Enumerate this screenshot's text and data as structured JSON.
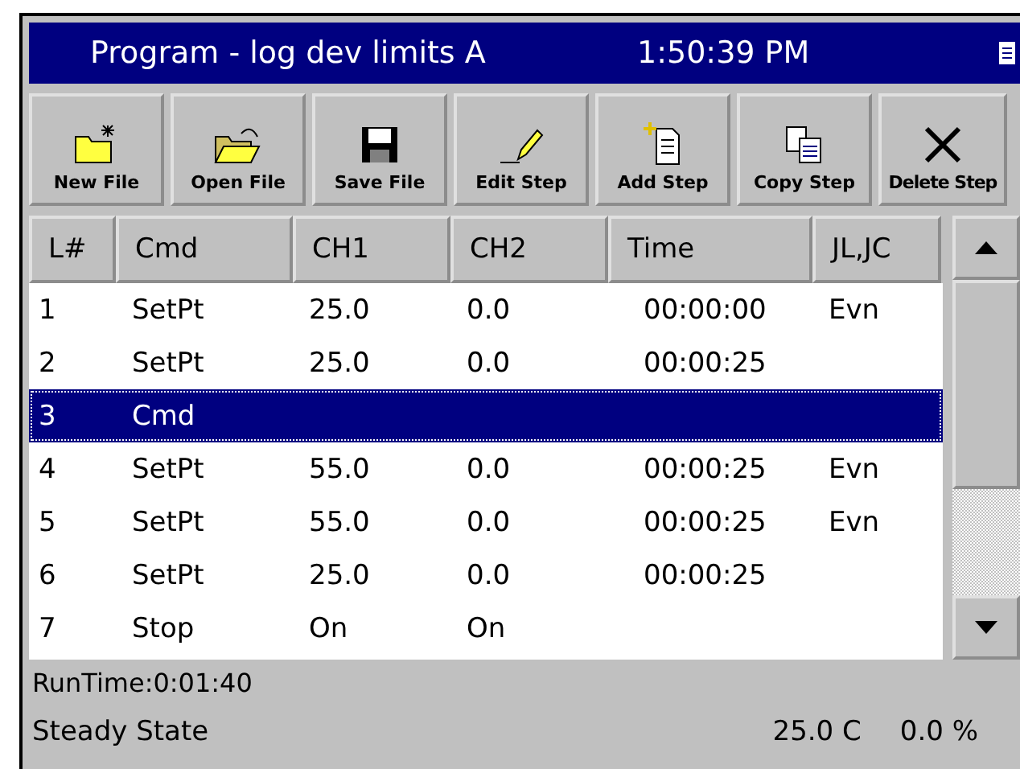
{
  "window": {
    "title": "Program - log dev limits A",
    "clock": "1:50:39 PM"
  },
  "toolbar": [
    {
      "kind": "new",
      "label": "New File"
    },
    {
      "kind": "open",
      "label": "Open File"
    },
    {
      "kind": "save",
      "label": "Save File"
    },
    {
      "kind": "edit",
      "label": "Edit Step"
    },
    {
      "kind": "add",
      "label": "Add Step"
    },
    {
      "kind": "copy",
      "label": "Copy Step"
    },
    {
      "kind": "delete",
      "label": "Delete Step"
    }
  ],
  "table": {
    "columns": [
      "L#",
      "Cmd",
      "CH1",
      "CH2",
      "Time",
      "JL,JC"
    ],
    "rows": [
      {
        "cells": [
          "1",
          "SetPt",
          "25.0",
          "0.0",
          "00:00:00",
          "Evn"
        ],
        "selected": false
      },
      {
        "cells": [
          "2",
          "SetPt",
          "25.0",
          "0.0",
          "00:00:25"
        ],
        "selected": false
      },
      {
        "cells": [
          "3",
          "Cmd"
        ],
        "selected": true
      },
      {
        "cells": [
          "4",
          "SetPt",
          "55.0",
          "0.0",
          "00:00:25",
          "Evn"
        ],
        "selected": false
      },
      {
        "cells": [
          "5",
          "SetPt",
          "55.0",
          "0.0",
          "00:00:25",
          "Evn"
        ],
        "selected": false
      },
      {
        "cells": [
          "6",
          "SetPt",
          "25.0",
          "0.0",
          "00:00:25"
        ],
        "selected": false
      },
      {
        "cells": [
          "7",
          "Stop",
          "On",
          "On"
        ],
        "selected": false
      }
    ]
  },
  "status_bar": {
    "runtime": "RunTime:0:01:40",
    "state": "Steady State",
    "temperature": "25.0 C",
    "output": "0.0 %"
  }
}
